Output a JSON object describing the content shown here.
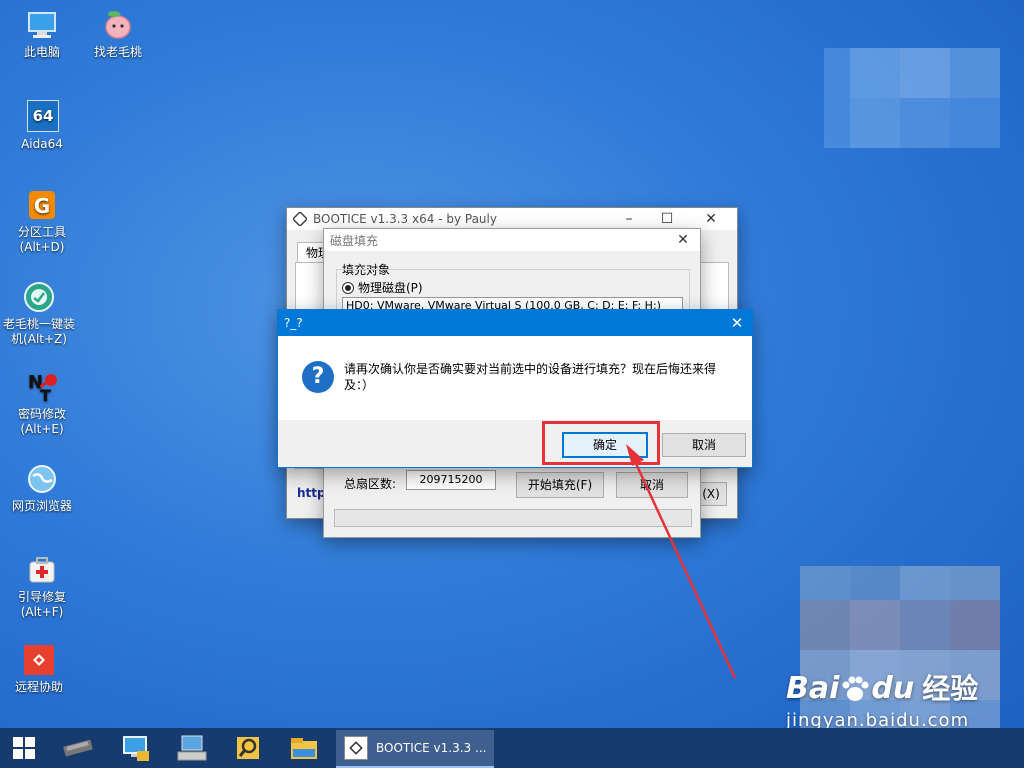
{
  "desktop": {
    "icons": [
      {
        "label": "此电脑",
        "icon": "computer-icon"
      },
      {
        "label": "找老毛桃",
        "icon": "peach-icon"
      },
      {
        "label": "Aida64",
        "icon": "aida64-icon"
      },
      {
        "label": "分区工具\n(Alt+D)",
        "icon": "partition-tool-icon"
      },
      {
        "label": "老毛桃一键装\n机(Alt+Z)",
        "icon": "one-click-install-icon"
      },
      {
        "label": "密码修改\n(Alt+E)",
        "icon": "password-edit-icon"
      },
      {
        "label": "网页浏览器",
        "icon": "browser-icon"
      },
      {
        "label": "引导修复\n(Alt+F)",
        "icon": "boot-repair-icon"
      },
      {
        "label": "远程协助",
        "icon": "remote-assist-icon"
      }
    ],
    "aida_badge": "64"
  },
  "bootice": {
    "title": "BOOTICE v1.3.3 x64 - by Pauly",
    "tab_label": "物理",
    "url_partial": "http:",
    "close_button_partial": "(X)"
  },
  "fill_dialog": {
    "title": "磁盘填充",
    "group_label": "填充对象",
    "radio_label": "物理磁盘(P)",
    "disk_select_value": "HD0: VMware, VMware Virtual S (100.0 GB, C: D: E: F: H:)",
    "sector_count_label": "总扇区数:",
    "sector_count_value": "209715200",
    "start_button": "开始填充(F)",
    "cancel_button": "取消"
  },
  "confirm_dialog": {
    "title": "?_?",
    "message": "请再次确认你是否确实要对当前选中的设备进行填充？现在后悔还来得及：）",
    "ok_button": "确定",
    "cancel_button": "取消",
    "icon": "question-icon"
  },
  "taskbar": {
    "icons": [
      "start-icon",
      "hardware-chip-icon",
      "network-computer-icon",
      "keyboard-monitor-icon",
      "search-magnifier-icon",
      "file-explorer-icon"
    ],
    "active_task_label": "BOOTICE v1.3.3 ..."
  },
  "watermark": {
    "brand": "Bai",
    "brand_suffix": "du",
    "brand_cn": "经验",
    "url": "jingyan.baidu.com"
  },
  "colors": {
    "accent": "#0078d7",
    "annotation_red": "#e53339",
    "taskbar": "#173a6f"
  }
}
